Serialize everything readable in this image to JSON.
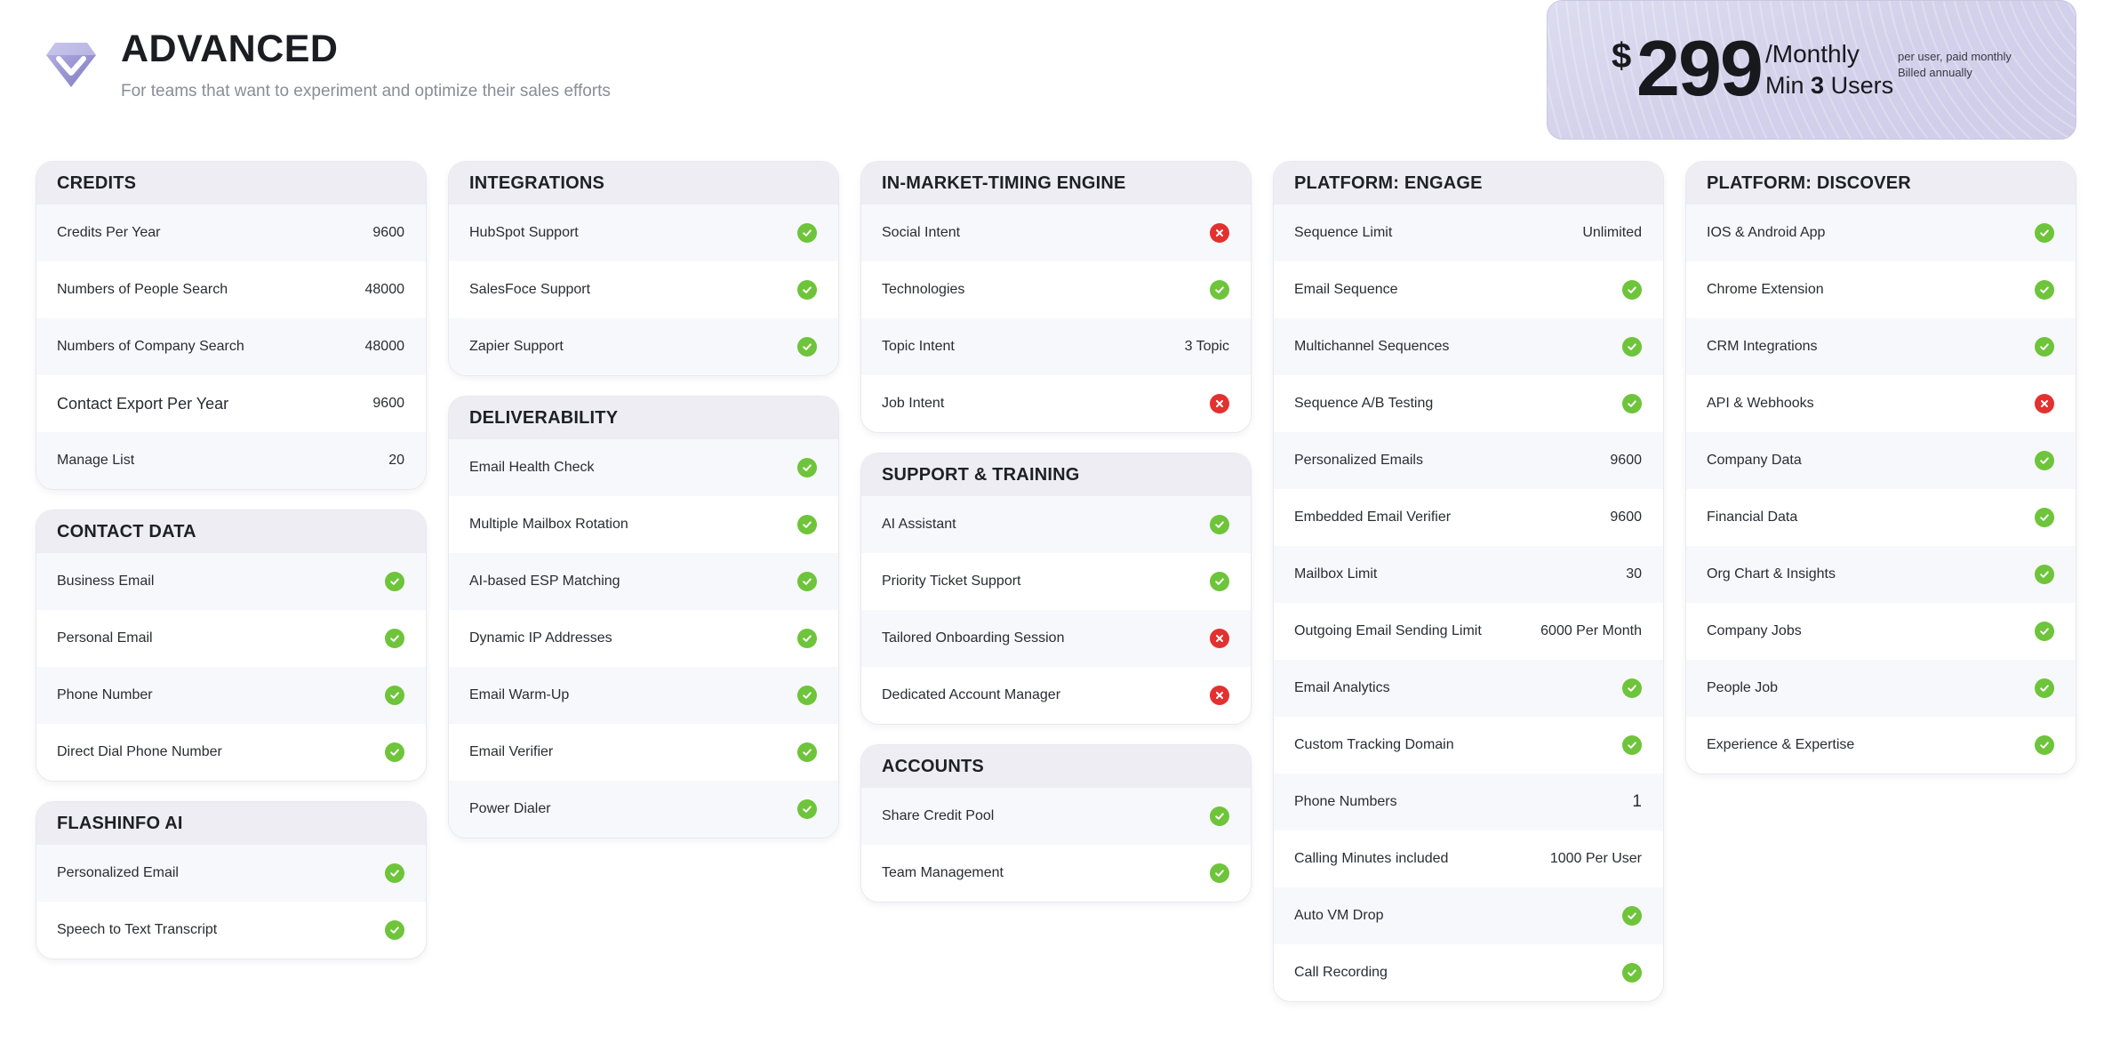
{
  "plan": {
    "title": "ADVANCED",
    "subtitle": "For teams that want to experiment and optimize their sales efforts"
  },
  "price": {
    "currency": "$",
    "amount": "299",
    "period": "/Monthly",
    "min_prefix": "Min",
    "min_users": "3",
    "min_suffix": "Users",
    "note_line1": "per user, paid monthly",
    "note_line2": "Billed annually"
  },
  "colors": {
    "check": "#6ec43a",
    "cross": "#e3312f",
    "accent": "#8a86c9"
  },
  "sections": {
    "credits": {
      "title": "CREDITS",
      "rows": [
        {
          "label": "Credits Per Year",
          "value": "9600"
        },
        {
          "label": "Numbers of People Search",
          "value": "48000"
        },
        {
          "label": "Numbers of Company Search",
          "value": "48000"
        },
        {
          "label": "Contact Export Per Year",
          "value": "9600"
        },
        {
          "label": "Manage List",
          "value": "20"
        }
      ]
    },
    "contact_data": {
      "title": "CONTACT DATA",
      "rows": [
        {
          "label": "Business Email",
          "status": "check-icon"
        },
        {
          "label": "Personal Email",
          "status": "check-icon"
        },
        {
          "label": "Phone Number",
          "status": "check-icon"
        },
        {
          "label": "Direct Dial Phone Number",
          "status": "check-icon"
        }
      ]
    },
    "flashinfo_ai": {
      "title": "FLASHINFO AI",
      "rows": [
        {
          "label": "Personalized Email",
          "status": "check-icon"
        },
        {
          "label": "Speech to Text Transcript",
          "status": "check-icon"
        }
      ]
    },
    "integrations": {
      "title": "INTEGRATIONS",
      "rows": [
        {
          "label": "HubSpot Support",
          "status": "check-icon"
        },
        {
          "label": "SalesFoce Support",
          "status": "check-icon"
        },
        {
          "label": "Zapier Support",
          "status": "check-icon"
        }
      ]
    },
    "deliverability": {
      "title": "DELIVERABILITY",
      "rows": [
        {
          "label": "Email Health Check",
          "status": "check-icon"
        },
        {
          "label": "Multiple Mailbox Rotation",
          "status": "check-icon"
        },
        {
          "label": "AI-based ESP Matching",
          "status": "check-icon"
        },
        {
          "label": "Dynamic IP Addresses",
          "status": "check-icon"
        },
        {
          "label": "Email Warm-Up",
          "status": "check-icon"
        },
        {
          "label": "Email Verifier",
          "status": "check-icon"
        },
        {
          "label": "Power Dialer",
          "status": "check-icon"
        }
      ]
    },
    "in_market_timing": {
      "title": "IN-MARKET-TIMING ENGINE",
      "rows": [
        {
          "label": "Social Intent",
          "status": "cross-icon"
        },
        {
          "label": "Technologies",
          "status": "check-icon"
        },
        {
          "label": "Topic Intent",
          "value": "3 Topic"
        },
        {
          "label": "Job Intent",
          "status": "cross-icon"
        }
      ]
    },
    "support_training": {
      "title": "SUPPORT & TRAINING",
      "rows": [
        {
          "label": "AI Assistant",
          "status": "check-icon"
        },
        {
          "label": "Priority Ticket Support",
          "status": "check-icon"
        },
        {
          "label": "Tailored Onboarding Session",
          "status": "cross-icon"
        },
        {
          "label": "Dedicated Account Manager",
          "status": "cross-icon"
        }
      ]
    },
    "accounts": {
      "title": "ACCOUNTS",
      "rows": [
        {
          "label": "Share Credit Pool",
          "status": "check-icon"
        },
        {
          "label": "Team Management",
          "status": "check-icon"
        }
      ]
    },
    "platform_engage": {
      "title": "PLATFORM: ENGAGE",
      "rows": [
        {
          "label": "Sequence Limit",
          "value": "Unlimited"
        },
        {
          "label": "Email Sequence",
          "status": "check-icon"
        },
        {
          "label": "Multichannel Sequences",
          "status": "check-icon"
        },
        {
          "label": "Sequence A/B Testing",
          "status": "check-icon"
        },
        {
          "label": "Personalized Emails",
          "value": "9600"
        },
        {
          "label": "Embedded Email Verifier",
          "value": "9600"
        },
        {
          "label": "Mailbox Limit",
          "value": "30"
        },
        {
          "label": "Outgoing Email Sending Limit",
          "value": "6000 Per Month"
        },
        {
          "label": "Email Analytics",
          "status": "check-icon"
        },
        {
          "label": "Custom Tracking Domain",
          "status": "check-icon"
        },
        {
          "label": "Phone Numbers",
          "value": "1"
        },
        {
          "label": "Calling Minutes included",
          "value": "1000 Per User"
        },
        {
          "label": "Auto VM Drop",
          "status": "check-icon"
        },
        {
          "label": "Call Recording",
          "status": "check-icon"
        }
      ]
    },
    "platform_discover": {
      "title": "PLATFORM: DISCOVER",
      "rows": [
        {
          "label": "IOS & Android App",
          "status": "check-icon"
        },
        {
          "label": "Chrome Extension",
          "status": "check-icon"
        },
        {
          "label": "CRM Integrations",
          "status": "check-icon"
        },
        {
          "label": "API & Webhooks",
          "status": "cross-icon"
        },
        {
          "label": "Company Data",
          "status": "check-icon"
        },
        {
          "label": "Financial Data",
          "status": "check-icon"
        },
        {
          "label": "Org Chart & Insights",
          "status": "check-icon"
        },
        {
          "label": "Company Jobs",
          "status": "check-icon"
        },
        {
          "label": "People Job",
          "status": "check-icon"
        },
        {
          "label": "Experience & Expertise",
          "status": "check-icon"
        }
      ]
    }
  }
}
